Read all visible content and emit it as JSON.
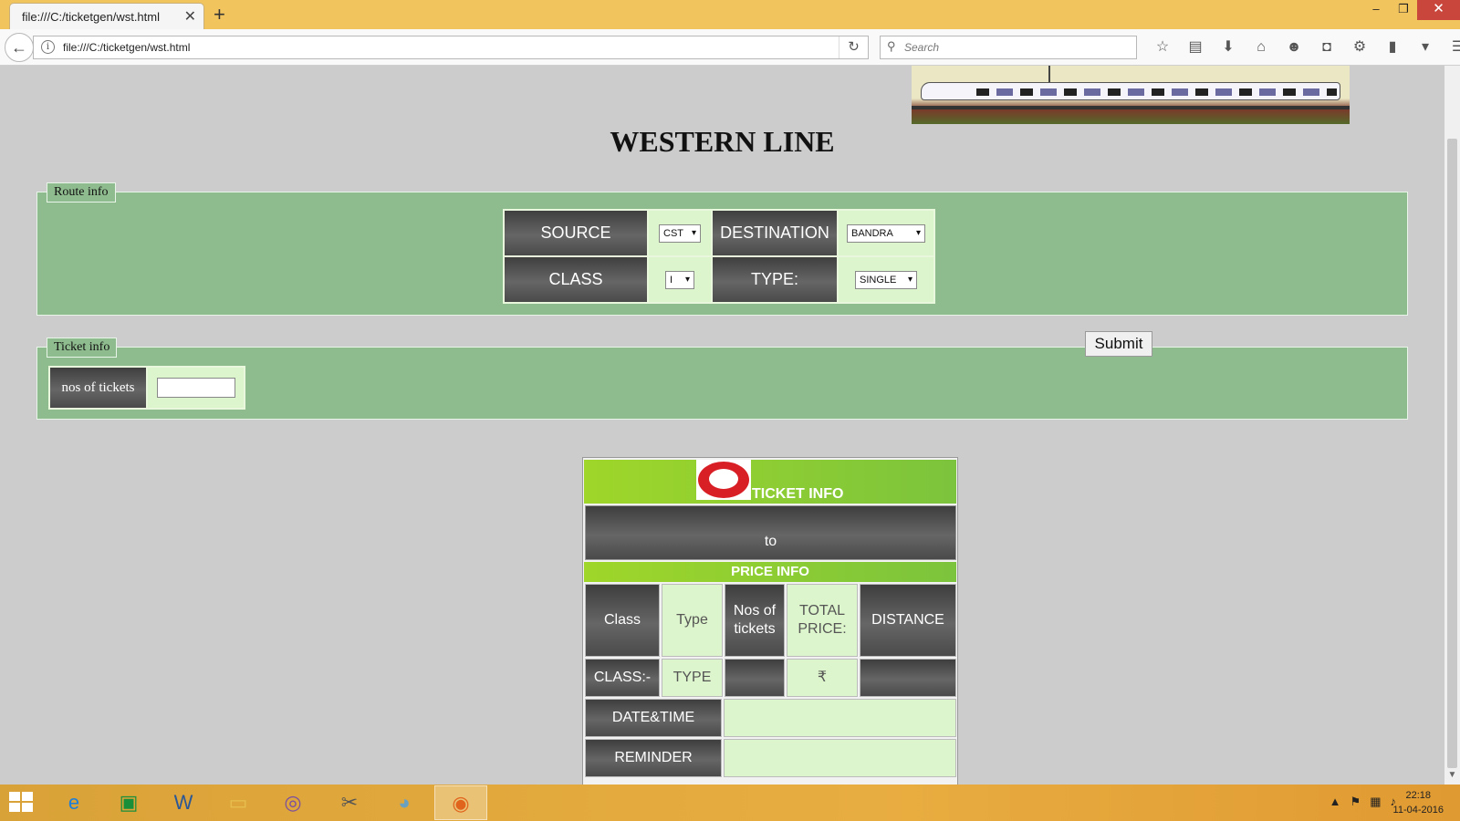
{
  "browser": {
    "tab_title": "file:///C:/ticketgen/wst.html",
    "url": "file:///C:/ticketgen/wst.html",
    "search_placeholder": "Search"
  },
  "page": {
    "title": "WESTERN LINE",
    "route_info": {
      "legend": "Route info",
      "source_label": "SOURCE",
      "source_value": "CST",
      "destination_label": "DESTINATION",
      "destination_value": "BANDRA",
      "class_label": "CLASS",
      "class_value": "I",
      "type_label": "TYPE:",
      "type_value": "SINGLE"
    },
    "submit_label": "Submit",
    "ticket_info": {
      "legend": "Ticket info",
      "tickets_label": "nos of tickets",
      "tickets_value": ""
    },
    "ticket_card": {
      "header": "TICKET INFO",
      "route_text": "to",
      "price_header": "PRICE INFO",
      "col_class": "Class",
      "col_type": "Type",
      "col_nos": "Nos of tickets",
      "col_total": "TOTAL PRICE:",
      "col_distance": "DISTANCE",
      "val_class": "CLASS:-",
      "val_type": "TYPE",
      "val_nos": "",
      "val_price": "₹",
      "val_distance": "",
      "datetime_label": "DATE&TIME",
      "datetime_value": "",
      "reminder_label": "REMINDER",
      "reminder_value": ""
    }
  },
  "taskbar": {
    "time": "22:18",
    "date": "11-04-2016"
  },
  "colors": {
    "panel": "#8fbc8f",
    "accent_green": "#9fd629",
    "dark_cell": "#555555",
    "light_cell": "#ddf5cc",
    "titlebar": "#f2c45e"
  }
}
